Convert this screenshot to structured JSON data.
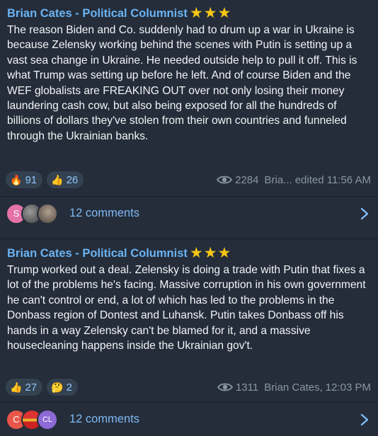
{
  "posts": [
    {
      "author": "Brian Cates - Political Columnist",
      "stars": "★★★",
      "text": "The reason Biden and Co. suddenly had to drum up a war in Ukraine is because Zelensky working behind the scenes with Putin is setting up a vast sea change in Ukraine.  He needed outside help to pull it off.  This is what Trump was setting up before he left. And of course Biden and the WEF globalists are FREAKING OUT over not only losing their money laundering cash cow, but also being exposed for all the hundreds of billions of dollars they've stolen from their own countries and funneled through the Ukrainian banks.",
      "reactions": [
        {
          "emoji": "🔥",
          "icon": "fire-emoji",
          "count": "91"
        },
        {
          "emoji": "👍",
          "icon": "thumbs-up-emoji",
          "count": "26"
        }
      ],
      "views": "2284",
      "signature": "Bria...",
      "edited": "edited 11:56 AM",
      "comment_avatars": [
        {
          "kind": "letter",
          "text": "S",
          "color": "#e573a8"
        },
        {
          "kind": "photo",
          "text": ""
        },
        {
          "kind": "photo",
          "text": ""
        }
      ],
      "comments_label": "12 comments"
    },
    {
      "author": "Brian Cates - Political Columnist",
      "stars": "★★★",
      "text": "Trump worked out a deal. Zelensky is doing a trade with Putin that fixes a lot of the problems he's facing.  Massive corruption in his own government he can't control or end, a lot of which has led to the problems in the Donbass region of Dontest and Luhansk. Putin takes Donbass off his hands in a way Zelensky can't be blamed for it, and a massive housecleaning happens inside the Ukrainian gov't.",
      "reactions": [
        {
          "emoji": "👍",
          "icon": "thumbs-up-emoji",
          "count": "27"
        },
        {
          "emoji": "🤔",
          "icon": "thinking-face-emoji",
          "count": "2"
        }
      ],
      "views": "1311",
      "signature": "Brian Cates,",
      "edited": "12:03 PM",
      "comment_avatars": [
        {
          "kind": "letter",
          "text": "C",
          "color": "#e8574a"
        },
        {
          "kind": "flag",
          "text": ""
        },
        {
          "kind": "letter",
          "text": "CL",
          "color": "#8d6ad6"
        }
      ],
      "comments_label": "12 comments"
    }
  ],
  "colors": {
    "background": "#1e2631",
    "card": "#252d3a",
    "author": "#6ab3f3",
    "star": "#f5c518",
    "link": "#7fb9f5",
    "meta": "#8a96a3",
    "reaction_bg": "#344150"
  }
}
